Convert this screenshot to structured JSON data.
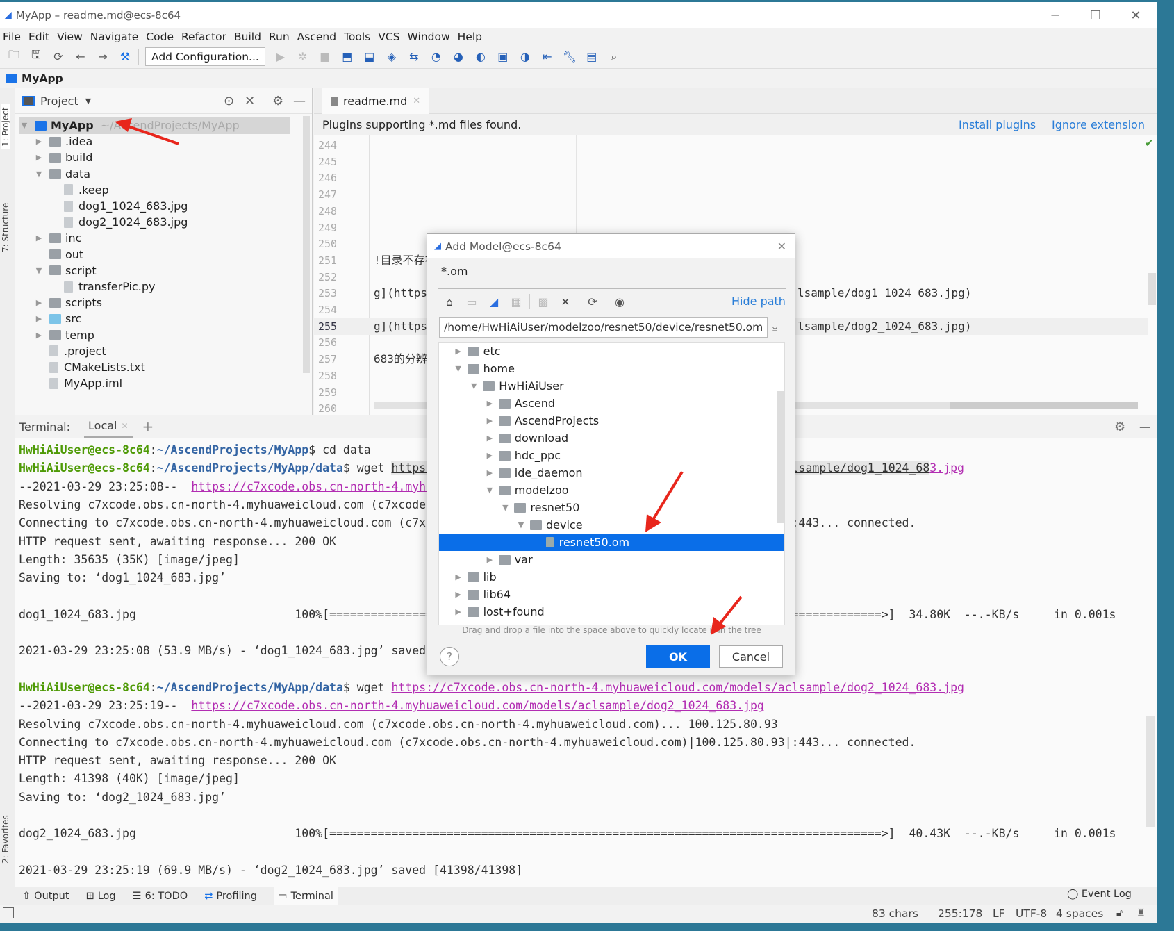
{
  "window": {
    "title": "MyApp – readme.md@ecs-8c64",
    "controls": [
      "minimize",
      "maximize",
      "close"
    ]
  },
  "menu": [
    "File",
    "Edit",
    "View",
    "Navigate",
    "Code",
    "Refactor",
    "Build",
    "Run",
    "Ascend",
    "Tools",
    "VCS",
    "Window",
    "Help"
  ],
  "toolbar": {
    "left_icons": [
      "open-folder",
      "save",
      "sync",
      "back",
      "forward",
      "build-hammer"
    ],
    "config_label": "Add Configuration...",
    "right_icons": [
      "run",
      "debug",
      "stop",
      "deploy",
      "model-convert",
      "model-visualizer",
      "app-sync",
      "profiling-start",
      "profiling-data",
      "system-profiler",
      "ide-terminal",
      "log-view",
      "project-export",
      "settings-wrench",
      "project-structure",
      "search"
    ]
  },
  "navbar": {
    "project": "MyApp"
  },
  "left_strip": {
    "project": "1: Project",
    "structure": "7: Structure",
    "favorites": "2: Favorites"
  },
  "project_panel": {
    "title": "Project",
    "tree": [
      {
        "label": "MyApp",
        "hint": "~/AscendProjects/MyApp",
        "level": 0,
        "kind": "root",
        "state": "open"
      },
      {
        "label": ".idea",
        "level": 1,
        "kind": "folder",
        "state": "closed"
      },
      {
        "label": "build",
        "level": 1,
        "kind": "folder",
        "state": "closed"
      },
      {
        "label": "data",
        "level": 1,
        "kind": "folder",
        "state": "open"
      },
      {
        "label": ".keep",
        "level": 2,
        "kind": "file"
      },
      {
        "label": "dog1_1024_683.jpg",
        "level": 2,
        "kind": "image"
      },
      {
        "label": "dog2_1024_683.jpg",
        "level": 2,
        "kind": "image"
      },
      {
        "label": "inc",
        "level": 1,
        "kind": "folder",
        "state": "closed"
      },
      {
        "label": "out",
        "level": 1,
        "kind": "folder",
        "state": "none"
      },
      {
        "label": "script",
        "level": 1,
        "kind": "folder",
        "state": "open"
      },
      {
        "label": "transferPic.py",
        "level": 2,
        "kind": "file"
      },
      {
        "label": "scripts",
        "level": 1,
        "kind": "folder",
        "state": "closed"
      },
      {
        "label": "src",
        "level": 1,
        "kind": "source",
        "state": "closed"
      },
      {
        "label": "temp",
        "level": 1,
        "kind": "folder",
        "state": "closed"
      },
      {
        "label": ".project",
        "level": 1,
        "kind": "file"
      },
      {
        "label": "CMakeLists.txt",
        "level": 1,
        "kind": "file"
      },
      {
        "label": "MyApp.iml",
        "level": 1,
        "kind": "file"
      }
    ]
  },
  "editor": {
    "tab": "readme.md",
    "banner": {
      "text": "Plugins supporting *.md files found.",
      "install": "Install plugins",
      "ignore": "Ignore extension"
    },
    "line_numbers": [
      "244",
      "245",
      "246",
      "247",
      "248",
      "249",
      "250",
      "251",
      "252",
      "253",
      "254",
      "255",
      "256",
      "257",
      "258",
      "259",
      "260"
    ],
    "current_line": "255",
    "fragments": [
      {
        "line": "251",
        "left": "!目录不存在",
        "right": ""
      },
      {
        "line": "253",
        "left": "g](https",
        "right": "lsample/dog1_1024_683.jpg)"
      },
      {
        "line": "255",
        "left": "g](https",
        "right": "lsample/dog2_1024_683.jpg)"
      },
      {
        "line": "257",
        "left": "683的分辨",
        "right": ""
      }
    ]
  },
  "terminal": {
    "label": "Terminal:",
    "tab": "Local",
    "lines": [
      [
        {
          "t": "HwHiAiUser@ecs-8c64",
          "c": "u"
        },
        {
          "t": ":",
          "c": ""
        },
        {
          "t": "~/AscendProjects/MyApp",
          "c": "p"
        },
        {
          "t": "$ cd data",
          "c": ""
        }
      ],
      [
        {
          "t": "HwHiAiUser@ecs-8c64",
          "c": "u"
        },
        {
          "t": ":",
          "c": ""
        },
        {
          "t": "~/AscendProjects/MyApp/data",
          "c": "p"
        },
        {
          "t": "$ wget ",
          "c": ""
        },
        {
          "t": "https://c7xcode.obs.cn-north-4.myhuaweicloud.com/models/aclsample/dog1_1024_68",
          "c": "lu"
        },
        {
          "t": "3.jpg",
          "c": "l"
        }
      ],
      [
        {
          "t": "--2021-03-29 23:25:08--  ",
          "c": ""
        },
        {
          "t": "https://c7xcode.obs.cn-north-4.myhuaweicloud.com/models/aclsample/dog1_1024_683.jpg",
          "c": "l"
        }
      ],
      [
        {
          "t": "Resolving c7xcode.obs.cn-north-4.myhuaweicloud.com (c7xcode.obs.cn-north-4.myhuaweicloud.com)... 100.125.80.93",
          "c": ""
        }
      ],
      [
        {
          "t": "Connecting to c7xcode.obs.cn-north-4.myhuaweicloud.com (c7xcode.obs.cn-north-4.myhuaweicloud.com)|100.125.80.93|:443... connected.",
          "c": ""
        }
      ],
      [
        {
          "t": "HTTP request sent, awaiting response... 200 OK",
          "c": ""
        }
      ],
      [
        {
          "t": "Length: 35635 (35K) [image/jpeg]",
          "c": ""
        }
      ],
      [
        {
          "t": "Saving to: ‘dog1_1024_683.jpg’",
          "c": ""
        }
      ],
      [],
      [
        {
          "t": "dog1_1024_683.jpg                       100%[================================================================================>]  34.80K  --.-KB/s     in 0.001s",
          "c": ""
        }
      ],
      [],
      [
        {
          "t": "2021-03-29 23:25:08 (53.9 MB/s) - ‘dog1_1024_683.jpg’ saved [35635/35635]",
          "c": ""
        }
      ],
      [],
      [
        {
          "t": "HwHiAiUser@ecs-8c64",
          "c": "u"
        },
        {
          "t": ":",
          "c": ""
        },
        {
          "t": "~/AscendProjects/MyApp/data",
          "c": "p"
        },
        {
          "t": "$ wget ",
          "c": ""
        },
        {
          "t": "https://c7xcode.obs.cn-north-4.myhuaweicloud.com/models/aclsample/dog2_1024_683.jpg",
          "c": "l"
        }
      ],
      [
        {
          "t": "--2021-03-29 23:25:19--  ",
          "c": ""
        },
        {
          "t": "https://c7xcode.obs.cn-north-4.myhuaweicloud.com/models/aclsample/dog2_1024_683.jpg",
          "c": "l"
        }
      ],
      [
        {
          "t": "Resolving c7xcode.obs.cn-north-4.myhuaweicloud.com (c7xcode.obs.cn-north-4.myhuaweicloud.com)... 100.125.80.93",
          "c": ""
        }
      ],
      [
        {
          "t": "Connecting to c7xcode.obs.cn-north-4.myhuaweicloud.com (c7xcode.obs.cn-north-4.myhuaweicloud.com)|100.125.80.93|:443... connected.",
          "c": ""
        }
      ],
      [
        {
          "t": "HTTP request sent, awaiting response... 200 OK",
          "c": ""
        }
      ],
      [
        {
          "t": "Length: 41398 (40K) [image/jpeg]",
          "c": ""
        }
      ],
      [
        {
          "t": "Saving to: ‘dog2_1024_683.jpg’",
          "c": ""
        }
      ],
      [],
      [
        {
          "t": "dog2_1024_683.jpg                       100%[================================================================================>]  40.43K  --.-KB/s     in 0.001s",
          "c": ""
        }
      ],
      [],
      [
        {
          "t": "2021-03-29 23:25:19 (69.9 MB/s) - ‘dog2_1024_683.jpg’ saved [41398/41398]",
          "c": ""
        }
      ]
    ]
  },
  "bottom_tools": [
    {
      "icon": "output",
      "label": "Output"
    },
    {
      "icon": "log",
      "label": "Log"
    },
    {
      "icon": "todo",
      "label": "6: TODO"
    },
    {
      "icon": "profiling",
      "label": "Profiling"
    },
    {
      "icon": "terminal",
      "label": "Terminal"
    }
  ],
  "event_log": "Event Log",
  "status": {
    "chars": "83 chars",
    "position": "255:178",
    "line_sep": "LF",
    "encoding": "UTF-8",
    "indent": "4 spaces"
  },
  "dialog": {
    "title": "Add Model@ecs-8c64",
    "filter": "*.om",
    "hide_path": "Hide path",
    "path": "/home/HwHiAiUser/modelzoo/resnet50/device/resnet50.om",
    "tools": [
      "home",
      "desktop",
      "project",
      "module",
      "new-folder",
      "delete",
      "refresh",
      "show-hidden"
    ],
    "tree": [
      {
        "label": "etc",
        "level": 1,
        "state": "closed"
      },
      {
        "label": "home",
        "level": 1,
        "state": "open"
      },
      {
        "label": "HwHiAiUser",
        "level": 2,
        "state": "open"
      },
      {
        "label": "Ascend",
        "level": 3,
        "state": "closed"
      },
      {
        "label": "AscendProjects",
        "level": 3,
        "state": "closed"
      },
      {
        "label": "download",
        "level": 3,
        "state": "closed"
      },
      {
        "label": "hdc_ppc",
        "level": 3,
        "state": "closed"
      },
      {
        "label": "ide_daemon",
        "level": 3,
        "state": "closed"
      },
      {
        "label": "modelzoo",
        "level": 3,
        "state": "open"
      },
      {
        "label": "resnet50",
        "level": 4,
        "state": "open"
      },
      {
        "label": "device",
        "level": 5,
        "state": "open"
      },
      {
        "label": "resnet50.om",
        "level": 6,
        "state": "file",
        "selected": true
      },
      {
        "label": "var",
        "level": 3,
        "state": "closed"
      },
      {
        "label": "lib",
        "level": 1,
        "state": "closed"
      },
      {
        "label": "lib64",
        "level": 1,
        "state": "closed"
      },
      {
        "label": "lost+found",
        "level": 1,
        "state": "closed"
      }
    ],
    "hint": "Drag and drop a file into the space above to quickly locate it in the tree",
    "ok": "OK",
    "cancel": "Cancel"
  },
  "colors": {
    "accent": "#0a6ee8",
    "annotation_arrow": "#e8261c",
    "prompt_user": "#4e9a06",
    "prompt_path": "#3465a4",
    "link": "#b22db2",
    "desktop_bg": "#2c7896"
  }
}
